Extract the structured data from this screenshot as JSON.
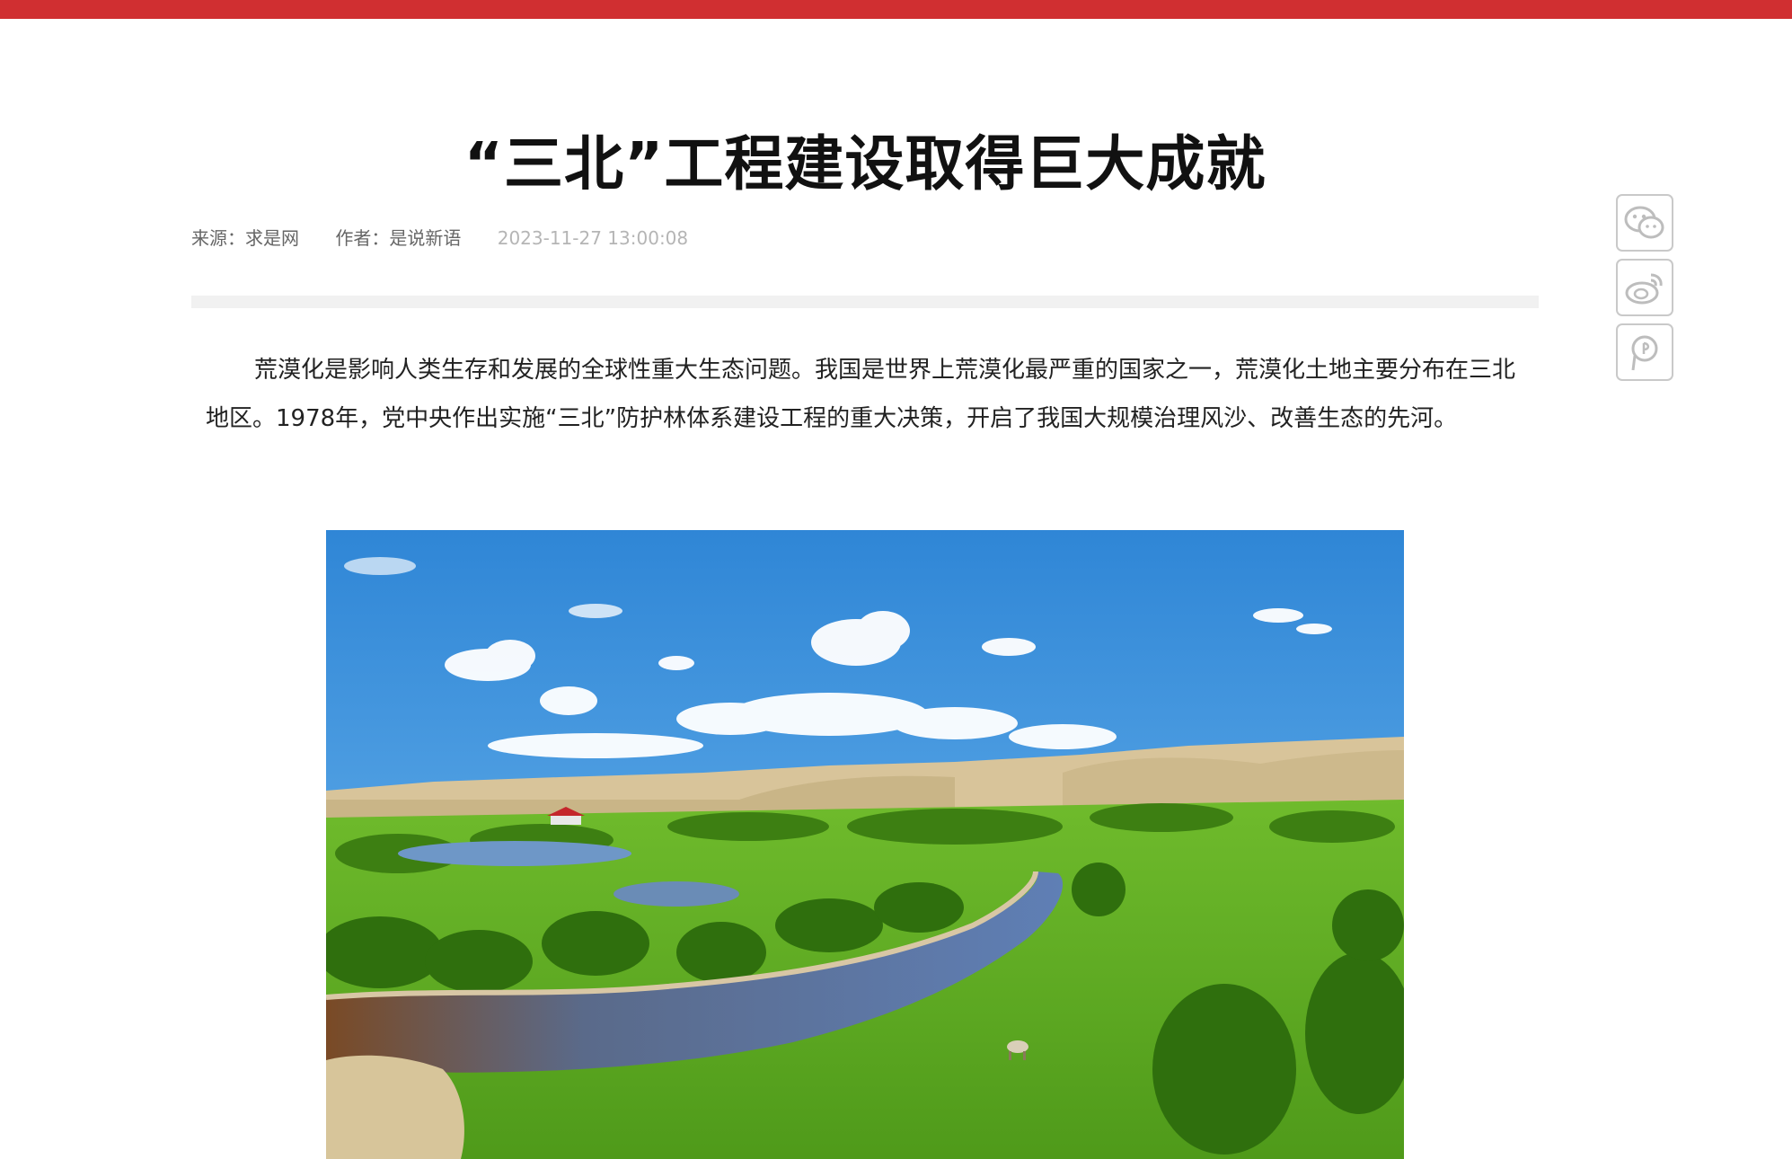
{
  "article": {
    "title": "“三北”工程建设取得巨大成就",
    "source": "来源：求是网",
    "author": "作者：是说新语",
    "date": "2023-11-27 13:00:08",
    "paragraph": "荒漠化是影响人类生存和发展的全球性重大生态问题。我国是世界上荒漠化最严重的国家之一，荒漠化土地主要分布在三北地区。1978年，党中央作出实施“三北”防护林体系建设工程的重大决策，开启了我国大规模治理风沙、改善生态的先河。"
  },
  "share": {
    "icons": [
      "wechat-icon",
      "weibo-icon",
      "pyq-icon"
    ]
  },
  "colors": {
    "accent": "#d02f31",
    "meta_text": "#666666",
    "date_text": "#b5b5b5"
  }
}
